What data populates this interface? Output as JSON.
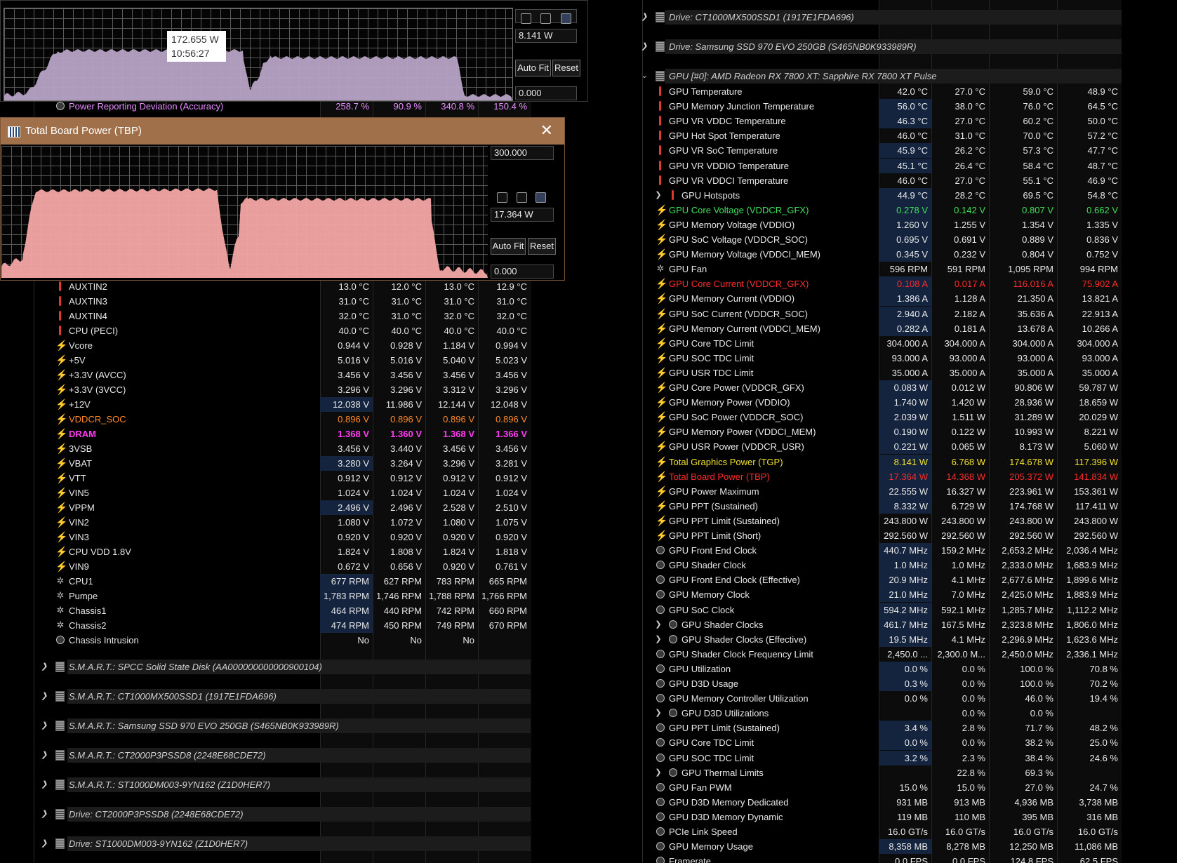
{
  "left": {
    "top_row": {
      "label": "Power Reporting Deviation (Accuracy)",
      "v": [
        "258.7 %",
        "90.9 %",
        "340.8 %",
        "150.4 %"
      ]
    },
    "rows": [
      {
        "icon": "temp",
        "label": "AUXTIN2",
        "v": [
          "13.0 °C",
          "12.0 °C",
          "13.0 °C",
          "12.9 °C"
        ]
      },
      {
        "icon": "temp",
        "label": "AUXTIN3",
        "v": [
          "31.0 °C",
          "31.0 °C",
          "31.0 °C",
          "31.0 °C"
        ]
      },
      {
        "icon": "temp",
        "label": "AUXTIN4",
        "v": [
          "32.0 °C",
          "31.0 °C",
          "32.0 °C",
          "32.0 °C"
        ]
      },
      {
        "icon": "temp",
        "label": "CPU (PECI)",
        "v": [
          "40.0 °C",
          "40.0 °C",
          "40.0 °C",
          "40.0 °C"
        ]
      },
      {
        "icon": "volt",
        "label": "Vcore",
        "v": [
          "0.944 V",
          "0.928 V",
          "1.184 V",
          "0.994 V"
        ]
      },
      {
        "icon": "volt",
        "label": "+5V",
        "v": [
          "5.016 V",
          "5.016 V",
          "5.040 V",
          "5.023 V"
        ]
      },
      {
        "icon": "volt",
        "label": "+3.3V (AVCC)",
        "v": [
          "3.456 V",
          "3.456 V",
          "3.456 V",
          "3.456 V"
        ]
      },
      {
        "icon": "volt",
        "label": "+3.3V (3VCC)",
        "v": [
          "3.296 V",
          "3.296 V",
          "3.312 V",
          "3.296 V"
        ]
      },
      {
        "icon": "volt",
        "label": "+12V",
        "v": [
          "12.038 V",
          "11.986 V",
          "12.144 V",
          "12.048 V"
        ],
        "hl": true
      },
      {
        "icon": "volt",
        "label": "VDDCR_SOC",
        "v": [
          "0.896 V",
          "0.896 V",
          "0.896 V",
          "0.896 V"
        ],
        "color": "orange"
      },
      {
        "icon": "volt",
        "label": "DRAM",
        "v": [
          "1.368 V",
          "1.360 V",
          "1.368 V",
          "1.366 V"
        ],
        "color": "magenta"
      },
      {
        "icon": "volt",
        "label": "3VSB",
        "v": [
          "3.456 V",
          "3.440 V",
          "3.456 V",
          "3.456 V"
        ]
      },
      {
        "icon": "volt",
        "label": "VBAT",
        "v": [
          "3.280 V",
          "3.264 V",
          "3.296 V",
          "3.281 V"
        ],
        "hl": true
      },
      {
        "icon": "volt",
        "label": "VTT",
        "v": [
          "0.912 V",
          "0.912 V",
          "0.912 V",
          "0.912 V"
        ]
      },
      {
        "icon": "volt",
        "label": "VIN5",
        "v": [
          "1.024 V",
          "1.024 V",
          "1.024 V",
          "1.024 V"
        ]
      },
      {
        "icon": "volt",
        "label": "VPPM",
        "v": [
          "2.496 V",
          "2.496 V",
          "2.528 V",
          "2.510 V"
        ],
        "hl": true
      },
      {
        "icon": "volt",
        "label": "VIN2",
        "v": [
          "1.080 V",
          "1.072 V",
          "1.080 V",
          "1.075 V"
        ]
      },
      {
        "icon": "volt",
        "label": "VIN3",
        "v": [
          "0.920 V",
          "0.920 V",
          "0.920 V",
          "0.920 V"
        ]
      },
      {
        "icon": "volt",
        "label": "CPU VDD 1.8V",
        "v": [
          "1.824 V",
          "1.808 V",
          "1.824 V",
          "1.818 V"
        ]
      },
      {
        "icon": "volt",
        "label": "VIN9",
        "v": [
          "0.672 V",
          "0.656 V",
          "0.920 V",
          "0.761 V"
        ]
      },
      {
        "icon": "fan",
        "label": "CPU1",
        "v": [
          "677 RPM",
          "627 RPM",
          "783 RPM",
          "665 RPM"
        ],
        "hl": true
      },
      {
        "icon": "fan",
        "label": "Pumpe",
        "v": [
          "1,783 RPM",
          "1,746 RPM",
          "1,788 RPM",
          "1,766 RPM"
        ],
        "hl": true
      },
      {
        "icon": "fan",
        "label": "Chassis1",
        "v": [
          "464 RPM",
          "440 RPM",
          "742 RPM",
          "660 RPM"
        ],
        "hl": true
      },
      {
        "icon": "fan",
        "label": "Chassis2",
        "v": [
          "474 RPM",
          "450 RPM",
          "749 RPM",
          "670 RPM"
        ],
        "hl": true
      },
      {
        "icon": "clock",
        "label": "Chassis Intrusion",
        "v": [
          "No",
          "No",
          "No",
          ""
        ]
      }
    ],
    "headers": [
      "S.M.A.R.T.: SPCC Solid State Disk (AA000000000000900104)",
      "S.M.A.R.T.: CT1000MX500SSD1 (1917E1FDA696)",
      "S.M.A.R.T.: Samsung SSD 970 EVO 250GB (S465NB0K933989R)",
      "S.M.A.R.T.: CT2000P3PSSD8 (2248E68CDE72)",
      "S.M.A.R.T.: ST1000DM003-9YN162 (Z1D0HER7)",
      "Drive: CT2000P3PSSD8 (2248E68CDE72)",
      "Drive: ST1000DM003-9YN162 (Z1D0HER7)"
    ]
  },
  "right": {
    "headers": [
      "Drive: CT1000MX500SSD1 (1917E1FDA696)",
      "Drive: Samsung SSD 970 EVO 250GB (S465NB0K933989R)",
      "GPU [#0]: AMD Radeon RX 7800 XT: Sapphire RX 7800 XT Pulse"
    ],
    "rows": [
      {
        "icon": "temp",
        "label": "GPU Temperature",
        "v": [
          "42.0 °C",
          "27.0 °C",
          "59.0 °C",
          "48.9 °C"
        ]
      },
      {
        "icon": "temp",
        "label": "GPU Memory Junction Temperature",
        "v": [
          "56.0 °C",
          "38.0 °C",
          "76.0 °C",
          "64.5 °C"
        ],
        "hl": true
      },
      {
        "icon": "temp",
        "label": "GPU VR VDDC Temperature",
        "v": [
          "46.3 °C",
          "27.0 °C",
          "60.2 °C",
          "50.0 °C"
        ],
        "hl": true
      },
      {
        "icon": "temp",
        "label": "GPU Hot Spot Temperature",
        "v": [
          "46.0 °C",
          "31.0 °C",
          "70.0 °C",
          "57.2 °C"
        ]
      },
      {
        "icon": "temp",
        "label": "GPU VR SoC Temperature",
        "v": [
          "45.9 °C",
          "26.2 °C",
          "57.3 °C",
          "47.7 °C"
        ],
        "hl": true
      },
      {
        "icon": "temp",
        "label": "GPU VR VDDIO Temperature",
        "v": [
          "45.1 °C",
          "26.4 °C",
          "58.4 °C",
          "48.7 °C"
        ],
        "hl": true
      },
      {
        "icon": "temp",
        "label": "GPU VR VDDCI Temperature",
        "v": [
          "46.0 °C",
          "27.0 °C",
          "55.1 °C",
          "46.9 °C"
        ]
      },
      {
        "icon": "temp",
        "label": "GPU Hotspots",
        "v": [
          "44.9 °C",
          "28.2 °C",
          "69.5 °C",
          "54.8 °C"
        ],
        "hl": true,
        "sub": true
      },
      {
        "icon": "volt",
        "label": "GPU Core Voltage (VDDCR_GFX)",
        "v": [
          "0.278 V",
          "0.142 V",
          "0.807 V",
          "0.662 V"
        ],
        "color": "green",
        "hl": true
      },
      {
        "icon": "volt",
        "label": "GPU Memory Voltage (VDDIO)",
        "v": [
          "1.260 V",
          "1.255 V",
          "1.354 V",
          "1.335 V"
        ],
        "hl": true
      },
      {
        "icon": "volt",
        "label": "GPU SoC Voltage (VDDCR_SOC)",
        "v": [
          "0.695 V",
          "0.691 V",
          "0.889 V",
          "0.836 V"
        ],
        "hl": true
      },
      {
        "icon": "volt",
        "label": "GPU Memory Voltage (VDDCI_MEM)",
        "v": [
          "0.345 V",
          "0.232 V",
          "0.804 V",
          "0.752 V"
        ],
        "hl": true
      },
      {
        "icon": "fan",
        "label": "GPU Fan",
        "v": [
          "596 RPM",
          "591 RPM",
          "1,095 RPM",
          "994 RPM"
        ]
      },
      {
        "icon": "volt",
        "label": "GPU Core Current (VDDCR_GFX)",
        "v": [
          "0.108 A",
          "0.017 A",
          "116.016 A",
          "75.902 A"
        ],
        "color": "red",
        "hl": true
      },
      {
        "icon": "volt",
        "label": "GPU Memory Current (VDDIO)",
        "v": [
          "1.386 A",
          "1.128 A",
          "21.350 A",
          "13.821 A"
        ],
        "hl": true
      },
      {
        "icon": "volt",
        "label": "GPU SoC Current (VDDCR_SOC)",
        "v": [
          "2.940 A",
          "2.182 A",
          "35.636 A",
          "22.913 A"
        ],
        "hl": true
      },
      {
        "icon": "volt",
        "label": "GPU Memory Current (VDDCI_MEM)",
        "v": [
          "0.282 A",
          "0.181 A",
          "13.678 A",
          "10.266 A"
        ],
        "hl": true
      },
      {
        "icon": "volt",
        "label": "GPU Core TDC Limit",
        "v": [
          "304.000 A",
          "304.000 A",
          "304.000 A",
          "304.000 A"
        ]
      },
      {
        "icon": "volt",
        "label": "GPU SOC TDC Limit",
        "v": [
          "93.000 A",
          "93.000 A",
          "93.000 A",
          "93.000 A"
        ]
      },
      {
        "icon": "volt",
        "label": "GPU USR TDC Limit",
        "v": [
          "35.000 A",
          "35.000 A",
          "35.000 A",
          "35.000 A"
        ]
      },
      {
        "icon": "volt",
        "label": "GPU Core Power (VDDCR_GFX)",
        "v": [
          "0.083 W",
          "0.012 W",
          "90.806 W",
          "59.787 W"
        ],
        "hl": true
      },
      {
        "icon": "volt",
        "label": "GPU Memory Power (VDDIO)",
        "v": [
          "1.740 W",
          "1.420 W",
          "28.936 W",
          "18.659 W"
        ],
        "hl": true
      },
      {
        "icon": "volt",
        "label": "GPU SoC Power (VDDCR_SOC)",
        "v": [
          "2.039 W",
          "1.511 W",
          "31.289 W",
          "20.029 W"
        ],
        "hl": true
      },
      {
        "icon": "volt",
        "label": "GPU Memory Power (VDDCI_MEM)",
        "v": [
          "0.190 W",
          "0.122 W",
          "10.993 W",
          "8.221 W"
        ],
        "hl": true
      },
      {
        "icon": "volt",
        "label": "GPU USR Power (VDDCR_USR)",
        "v": [
          "0.221 W",
          "0.065 W",
          "8.173 W",
          "5.060 W"
        ],
        "hl": true
      },
      {
        "icon": "volt",
        "label": "Total Graphics Power (TGP)",
        "v": [
          "8.141 W",
          "6.768 W",
          "174.678 W",
          "117.396 W"
        ],
        "color": "yellow",
        "hl": true
      },
      {
        "icon": "volt",
        "label": "Total Board Power (TBP)",
        "v": [
          "17.364 W",
          "14.368 W",
          "205.372 W",
          "141.834 W"
        ],
        "color": "red",
        "hl": true
      },
      {
        "icon": "volt",
        "label": "GPU Power Maximum",
        "v": [
          "22.555 W",
          "16.327 W",
          "223.961 W",
          "153.361 W"
        ],
        "hl": true
      },
      {
        "icon": "volt",
        "label": "GPU PPT (Sustained)",
        "v": [
          "8.332 W",
          "6.729 W",
          "174.768 W",
          "117.411 W"
        ],
        "hl": true
      },
      {
        "icon": "volt",
        "label": "GPU PPT Limit (Sustained)",
        "v": [
          "243.800 W",
          "243.800 W",
          "243.800 W",
          "243.800 W"
        ]
      },
      {
        "icon": "volt",
        "label": "GPU PPT Limit (Short)",
        "v": [
          "292.560 W",
          "292.560 W",
          "292.560 W",
          "292.560 W"
        ]
      },
      {
        "icon": "clock",
        "label": "GPU Front End Clock",
        "v": [
          "440.7 MHz",
          "159.2 MHz",
          "2,653.2 MHz",
          "2,036.4 MHz"
        ],
        "hl": true
      },
      {
        "icon": "clock",
        "label": "GPU Shader Clock",
        "v": [
          "1.0 MHz",
          "1.0 MHz",
          "2,333.0 MHz",
          "1,683.9 MHz"
        ],
        "hl": true
      },
      {
        "icon": "clock",
        "label": "GPU Front End Clock (Effective)",
        "v": [
          "20.9 MHz",
          "4.1 MHz",
          "2,677.6 MHz",
          "1,899.6 MHz"
        ],
        "hl": true
      },
      {
        "icon": "clock",
        "label": "GPU Memory Clock",
        "v": [
          "21.0 MHz",
          "7.0 MHz",
          "2,425.0 MHz",
          "1,883.9 MHz"
        ],
        "hl": true
      },
      {
        "icon": "clock",
        "label": "GPU SoC Clock",
        "v": [
          "594.2 MHz",
          "592.1 MHz",
          "1,285.7 MHz",
          "1,112.2 MHz"
        ],
        "hl": true
      },
      {
        "icon": "clock",
        "label": "GPU Shader Clocks",
        "v": [
          "461.7 MHz",
          "167.5 MHz",
          "2,323.8 MHz",
          "1,806.0 MHz"
        ],
        "hl": true,
        "sub": true
      },
      {
        "icon": "clock",
        "label": "GPU Shader Clocks (Effective)",
        "v": [
          "19.5 MHz",
          "4.1 MHz",
          "2,296.9 MHz",
          "1,623.6 MHz"
        ],
        "hl": true,
        "sub": true
      },
      {
        "icon": "clock",
        "label": "GPU Shader Clock Frequency Limit",
        "v": [
          "2,450.0 ...",
          "2,300.0 M...",
          "2,450.0 MHz",
          "2,336.1 MHz"
        ]
      },
      {
        "icon": "clock",
        "label": "GPU Utilization",
        "v": [
          "0.0 %",
          "0.0 %",
          "100.0 %",
          "70.8 %"
        ],
        "hl": true
      },
      {
        "icon": "clock",
        "label": "GPU D3D Usage",
        "v": [
          "0.3 %",
          "0.0 %",
          "100.0 %",
          "70.2 %"
        ],
        "hl": true
      },
      {
        "icon": "clock",
        "label": "GPU Memory Controller Utilization",
        "v": [
          "0.0 %",
          "0.0 %",
          "46.0 %",
          "19.4 %"
        ]
      },
      {
        "icon": "clock",
        "label": "GPU D3D Utilizations",
        "v": [
          "",
          "0.0 %",
          "0.0 %",
          ""
        ],
        "sub": true
      },
      {
        "icon": "clock",
        "label": "GPU PPT Limit (Sustained)",
        "v": [
          "3.4 %",
          "2.8 %",
          "71.7 %",
          "48.2 %"
        ],
        "hl": true
      },
      {
        "icon": "clock",
        "label": "GPU Core TDC Limit",
        "v": [
          "0.0 %",
          "0.0 %",
          "38.2 %",
          "25.0 %"
        ],
        "hl": true
      },
      {
        "icon": "clock",
        "label": "GPU SOC TDC Limit",
        "v": [
          "3.2 %",
          "2.3 %",
          "38.4 %",
          "24.6 %"
        ],
        "hl": true
      },
      {
        "icon": "clock",
        "label": "GPU Thermal Limits",
        "v": [
          "",
          "22.8 %",
          "69.3 %",
          ""
        ],
        "sub": true
      },
      {
        "icon": "clock",
        "label": "GPU Fan PWM",
        "v": [
          "15.0 %",
          "15.0 %",
          "27.0 %",
          "24.7 %"
        ]
      },
      {
        "icon": "clock",
        "label": "GPU D3D Memory Dedicated",
        "v": [
          "931 MB",
          "913 MB",
          "4,936 MB",
          "3,738 MB"
        ]
      },
      {
        "icon": "clock",
        "label": "GPU D3D Memory Dynamic",
        "v": [
          "119 MB",
          "110 MB",
          "395 MB",
          "316 MB"
        ]
      },
      {
        "icon": "clock",
        "label": "PCIe Link Speed",
        "v": [
          "16.0 GT/s",
          "16.0 GT/s",
          "16.0 GT/s",
          "16.0 GT/s"
        ]
      },
      {
        "icon": "clock",
        "label": "GPU Memory Usage",
        "v": [
          "8,358 MB",
          "8,278 MB",
          "12,250 MB",
          "11,086 MB"
        ],
        "hl": true
      },
      {
        "icon": "clock",
        "label": "Framerate",
        "v": [
          "0.0 FPS",
          "0.0 FPS",
          "124.8 FPS",
          "62.5 FPS"
        ]
      }
    ]
  },
  "graph1": {
    "tooltip_value": "172.655 W",
    "tooltip_time": "10:56:27",
    "top_field": "",
    "current_field": "8.141 W",
    "min_field": "0.000",
    "autofit": "Auto Fit",
    "reset": "Reset"
  },
  "graph2": {
    "title": "Total Board Power (TBP)",
    "close": "✕",
    "max_field": "300.000",
    "current_field": "17.364 W",
    "min_field": "0.000",
    "autofit": "Auto Fit",
    "reset": "Reset"
  },
  "icons": {
    "expand": "chevron-right-icon",
    "collapse": "chevron-down-icon",
    "volt": "⚡",
    "fan": "✲"
  },
  "colors": {
    "graph1_fill": "#b7a3c6",
    "graph2_fill": "#f6a7a7",
    "titlebar": "#a0704a",
    "highlight": "#14233e"
  }
}
